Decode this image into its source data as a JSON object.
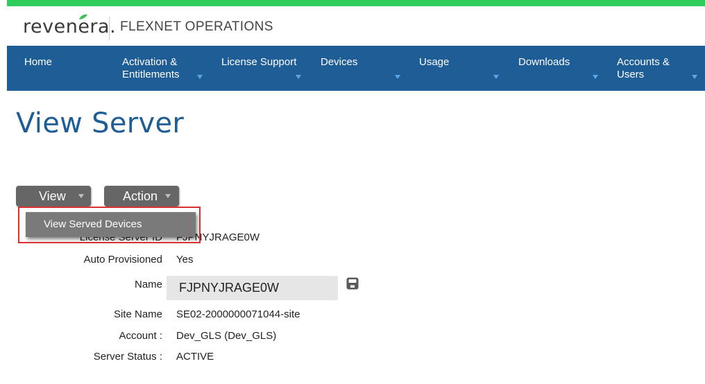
{
  "brand": {
    "logo": "revenera.",
    "product": "FLEXNET OPERATIONS"
  },
  "nav": [
    {
      "label": "Home"
    },
    {
      "label": "Activation &\nEntitlements"
    },
    {
      "label": "License Support"
    },
    {
      "label": "Devices"
    },
    {
      "label": "Usage"
    },
    {
      "label": "Downloads"
    },
    {
      "label": "Accounts &\nUsers"
    }
  ],
  "page": {
    "title": "View Server"
  },
  "toolbar": {
    "view_label": "View",
    "action_label": "Action"
  },
  "view_menu": {
    "items": [
      {
        "label": "View Served Devices"
      }
    ]
  },
  "details": {
    "license_server_id_label": "License Server ID",
    "license_server_id": "FJPNYJRAGE0W",
    "auto_provisioned_label": "Auto Provisioned",
    "auto_provisioned": "Yes",
    "name_label": "Name",
    "name_value": "FJPNYJRAGE0W",
    "site_name_label": "Site Name",
    "site_name": "SE02-2000000071044-site",
    "account_label": "Account :",
    "account": "Dev_GLS (Dev_GLS)",
    "server_status_label": "Server Status :",
    "server_status": "ACTIVE"
  },
  "colors": {
    "accent_bar": "#2ecc5b",
    "nav_bg": "#1f5d96",
    "title": "#1f5d96",
    "highlight": "#d93030"
  },
  "icons": {
    "save": "save-icon",
    "menu_caret": "chevron-down-icon",
    "logo_leaf": "leaf-icon"
  }
}
